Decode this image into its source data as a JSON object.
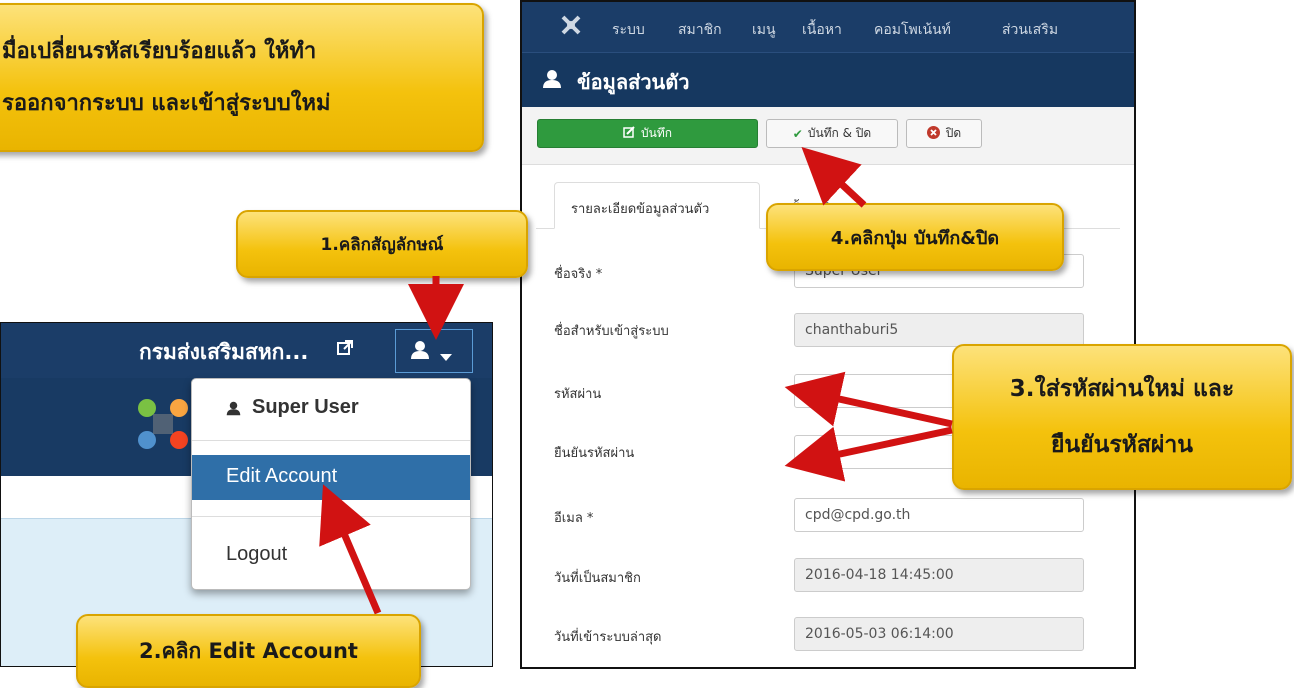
{
  "callouts": {
    "top_left_line1": "มื่อเปลี่ยนรหัสเรียบร้อยแล้ว ให้ทำ",
    "top_left_line2": "รออกจากระบบ และเข้าสู่ระบบใหม่",
    "step1": "1.คลิกสัญลักษณ์",
    "step2": "2.คลิก Edit Account",
    "step3_line1": "3.ใส่รหัสผ่านใหม่ และ",
    "step3_line2": "ยืนยันรหัสผ่าน",
    "step4": "4.คลิกปุ่ม บันทึก&ปิด"
  },
  "left_panel": {
    "site_name": "กรมส่งเสริมสหก...",
    "dropdown": {
      "user_name": "Super User",
      "edit_account": "Edit Account",
      "logout": "Logout"
    }
  },
  "right_panel": {
    "menu": [
      "ระบบ",
      "สมาชิก",
      "เมนู",
      "เนื้อหา",
      "คอมโพเน้นท์",
      "ส่วนเสริม"
    ],
    "title": "ข้อมูลส่วนตัว",
    "toolbar": {
      "save": "บันทึก",
      "save_close": "บันทึก & ปิด",
      "close": "ปิด"
    },
    "tabs": {
      "details": "รายละเอียดข้อมูลส่วนตัว",
      "settings_partial": "ตั้งค่าพื้นฐาน"
    },
    "form": {
      "name_label": "ชื่อจริง *",
      "name_value": "Super User",
      "username_label": "ชื่อสำหรับเข้าสู่ระบบ",
      "username_value": "chanthaburi5",
      "password_label": "รหัสผ่าน",
      "password_value": "",
      "confirm_label": "ยืนยันรหัสผ่าน",
      "confirm_value": "",
      "email_label": "อีเมล *",
      "email_value": "cpd@cpd.go.th",
      "register_label": "วันที่เป็นสมาชิก",
      "register_value": "2016-04-18 14:45:00",
      "lastvisit_label": "วันที่เข้าระบบล่าสุด",
      "lastvisit_value": "2016-05-03 06:14:00"
    }
  },
  "colors": {
    "navy": "#1b3d68",
    "callout_yellow": "#f4c20d",
    "arrow_red": "#d11212",
    "save_green": "#2f9a3e",
    "highlight_blue": "#2f6fa8"
  }
}
